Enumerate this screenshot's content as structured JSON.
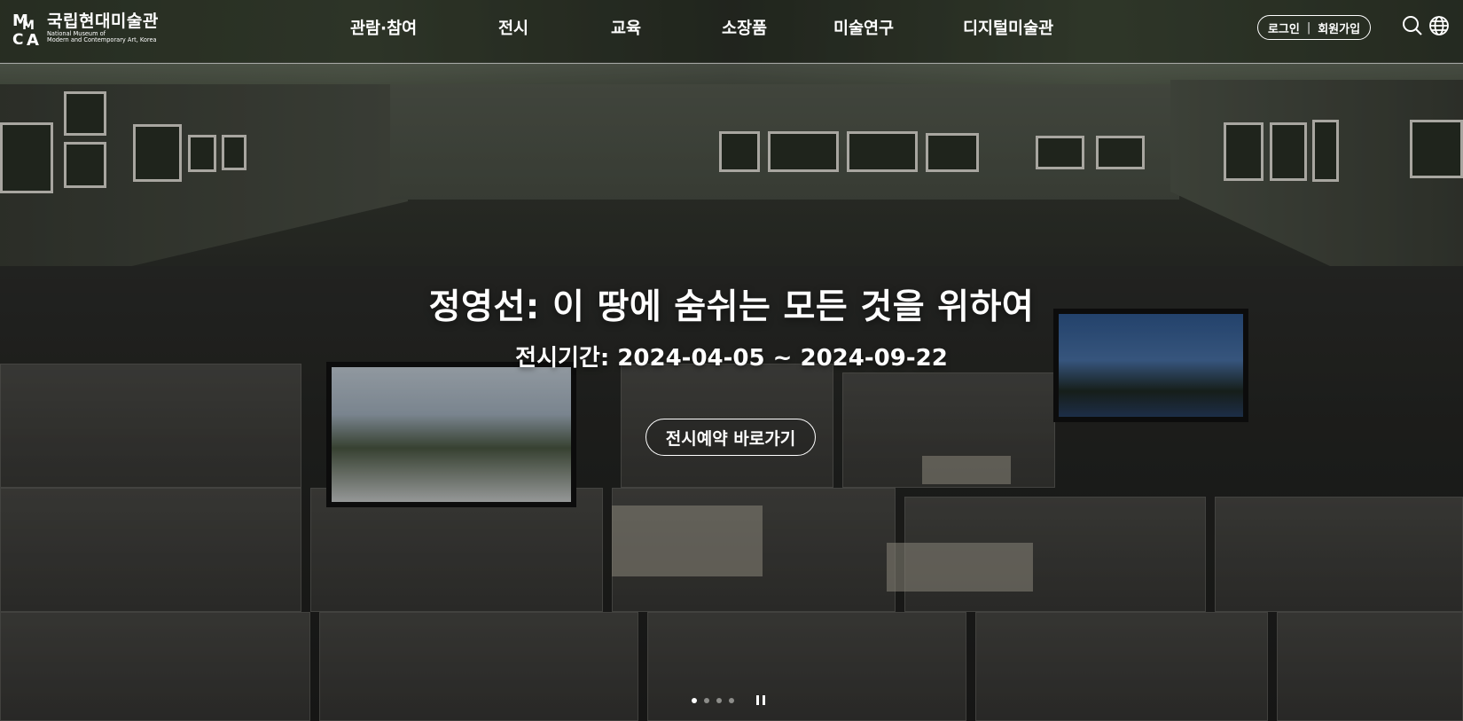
{
  "logo": {
    "name_ko": "국립현대미술관",
    "name_en_line1": "National Museum of",
    "name_en_line2": "Modern and Contemporary Art, Korea",
    "mark_icon": "mmca-logo-mark"
  },
  "nav": {
    "items": [
      {
        "label": "관람·참여"
      },
      {
        "label": "전시"
      },
      {
        "label": "교육"
      },
      {
        "label": "소장품"
      },
      {
        "label": "미술연구"
      },
      {
        "label": "디지털미술관"
      }
    ]
  },
  "auth": {
    "login_label": "로그인",
    "separator": "|",
    "signup_label": "회원가입"
  },
  "icons": {
    "search": "search-icon",
    "language": "globe-icon"
  },
  "hero": {
    "title": "정영선: 이 땅에 숨쉬는 모든 것을 위하여",
    "period": "전시기간: 2024-04-05 ~ 2024-09-22",
    "cta_label": "전시예약 바로가기"
  },
  "slider": {
    "total_slides": 4,
    "active_index": 0,
    "pause_icon": "pause-icon"
  },
  "colors": {
    "text": "#ffffff",
    "header_line": "#ffffff"
  }
}
